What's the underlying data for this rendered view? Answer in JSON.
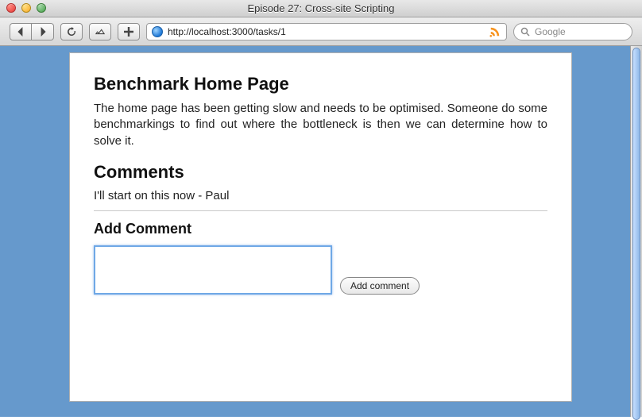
{
  "window": {
    "title": "Episode 27: Cross-site Scripting"
  },
  "toolbar": {
    "url": "http://localhost:3000/tasks/1",
    "search_placeholder": "Google"
  },
  "content": {
    "heading": "Benchmark Home Page",
    "body": "The home page has been getting slow and needs to be optimised. Someone do some benchmarkings to find out where the bottleneck is then we can determine how to solve it.",
    "comments_heading": "Comments",
    "comments": [
      "I'll start on this now - Paul"
    ],
    "add_comment_heading": "Add Comment",
    "add_comment_button": "Add comment",
    "textarea_value": ""
  }
}
